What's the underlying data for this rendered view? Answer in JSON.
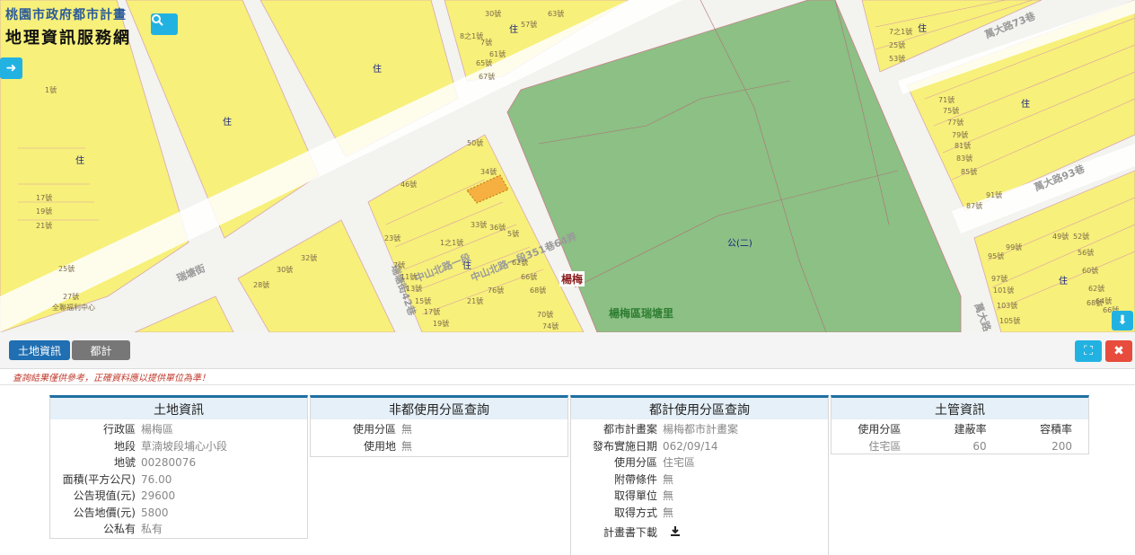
{
  "site": {
    "title_line1": "桃園市政府都市計畫",
    "title_line2": "地理資訊服務網"
  },
  "map": {
    "roads": [
      "中山北路一段",
      "中山北路一段351巷64弄",
      "楊梅",
      "楊梅區瑞塘里",
      "萬大路73巷",
      "萬大路93巷",
      "萬大路",
      "瑞塘街42巷",
      "瑞塘街"
    ],
    "zone_labels": [
      "住",
      "公(二)"
    ],
    "house_numbers": [
      "1號",
      "17號",
      "19號",
      "21號",
      "25號",
      "27號",
      "全聯福利中心",
      "30號",
      "32號",
      "28號",
      "46號",
      "50號",
      "34號",
      "33號",
      "36號",
      "23號",
      "7號",
      "11號",
      "13號",
      "15號",
      "17號",
      "19號",
      "21號",
      "5號",
      "62號",
      "66號",
      "68號",
      "70號",
      "74號",
      "76號",
      "1之1號",
      "8之1號",
      "7號",
      "30號",
      "61號",
      "65號",
      "67號",
      "63號",
      "57號",
      "71號",
      "75號",
      "77號",
      "79號",
      "81號",
      "83號",
      "85號",
      "87號",
      "91號",
      "95號",
      "97號",
      "101號",
      "103號",
      "105號",
      "99號",
      "49號",
      "52號",
      "56號",
      "60號",
      "62號",
      "64號",
      "66號",
      "68號",
      "7之1號",
      "25號",
      "53號",
      "33號"
    ]
  },
  "toolbar": {
    "tab_land": "土地資訊",
    "tab_urban": "都計"
  },
  "disclaimer": "查詢結果僅供參考，正確資料應以提供單位為準！",
  "cards": {
    "land": {
      "title": "土地資訊",
      "rows": [
        {
          "k": "行政區",
          "v": "楊梅區"
        },
        {
          "k": "地段",
          "v": "草湳坡段埔心小段"
        },
        {
          "k": "地號",
          "v": "00280076"
        },
        {
          "k": "面積(平方公尺)",
          "v": "76.00"
        },
        {
          "k": "公告現值(元)",
          "v": "29600"
        },
        {
          "k": "公告地價(元)",
          "v": "5800"
        },
        {
          "k": "公私有",
          "v": "私有"
        }
      ]
    },
    "non_urban": {
      "title": "非都使用分區查詢",
      "rows": [
        {
          "k": "使用分區",
          "v": "無"
        },
        {
          "k": "使用地",
          "v": "無"
        }
      ]
    },
    "urban": {
      "title": "都計使用分區查詢",
      "rows": [
        {
          "k": "都市計畫案",
          "v": "楊梅都市計畫案"
        },
        {
          "k": "發布實施日期",
          "v": "062/09/14"
        },
        {
          "k": "使用分區",
          "v": "住宅區"
        },
        {
          "k": "附帶條件",
          "v": "無"
        },
        {
          "k": "取得單位",
          "v": "無"
        },
        {
          "k": "取得方式",
          "v": "無"
        }
      ],
      "download_label": "計畫書下載"
    },
    "land_control": {
      "title": "土管資訊",
      "headers": [
        "使用分區",
        "建蔽率",
        "容積率"
      ],
      "values": [
        "住宅區",
        "60",
        "200"
      ]
    }
  },
  "icons": [
    "search-icon",
    "arrow-right-icon",
    "arrow-down-icon",
    "expand-icon",
    "close-icon",
    "download-icon"
  ],
  "colors": {
    "accent": "#22b2e2",
    "residential": "#f7f07a",
    "park": "#8cc084",
    "tab_active": "#1f6fb2",
    "close": "#e74c3c"
  }
}
